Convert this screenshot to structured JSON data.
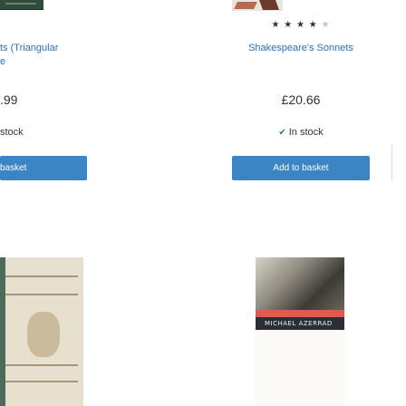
{
  "products": [
    {
      "title_lines": [
        "ts (Triangular",
        "e"
      ],
      "price": ".99",
      "stock": "stock",
      "button_label": "basket"
    },
    {
      "rating": {
        "filled": 4,
        "total": 5,
        "filled_glyph": "★",
        "empty_glyph": "★"
      },
      "title": "Shakespeare's Sonnets",
      "price": "£20.66",
      "stock_icon": "checkmark-icon",
      "stock": "In stock",
      "button_label": "Add to basket"
    }
  ],
  "covers": {
    "bottom_right_author": "MICHAEL AZERRAD"
  },
  "colors": {
    "link": "#2a73b8",
    "button": "#3c85c4",
    "button_text": "#ffffff",
    "text": "#333333",
    "star_empty": "#c6c6c6"
  }
}
